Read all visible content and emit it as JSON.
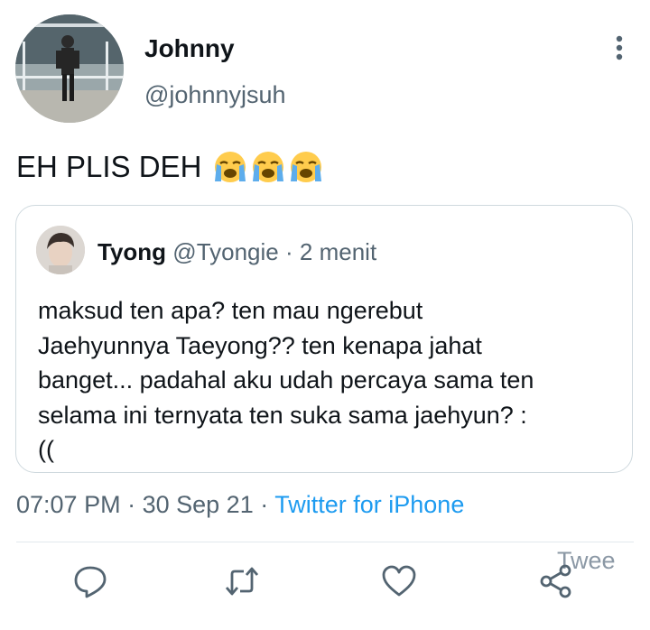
{
  "author": {
    "name": "Johnny",
    "handle": "@johnnyjsuh"
  },
  "tweet": {
    "text": "EH PLIS DEH",
    "emojis": [
      "crying-face",
      "crying-face",
      "crying-face"
    ]
  },
  "quoted_tweet": {
    "name": "Tyong",
    "handle": "@Tyongie",
    "separator": "·",
    "time": "2 menit",
    "body_lines": [
      "maksud ten apa? ten mau ngerebut",
      "Jaehyunnya Taeyong?? ten kenapa jahat",
      "banget... padahal aku udah percaya sama ten",
      "selama ini ternyata ten suka sama jaehyun? :",
      "(("
    ]
  },
  "meta": {
    "time": "07:07 PM",
    "sep1": "·",
    "date": "30 Sep 21",
    "sep2": "·",
    "source": "Twitter for iPhone"
  },
  "actions": {
    "icons": [
      "reply-icon",
      "retweet-icon",
      "like-icon",
      "share-icon"
    ],
    "tooltip": "Twee"
  },
  "colors": {
    "text": "#0f1419",
    "secondary": "#536471",
    "link": "#1d9bf0",
    "border": "#cfd9de"
  }
}
